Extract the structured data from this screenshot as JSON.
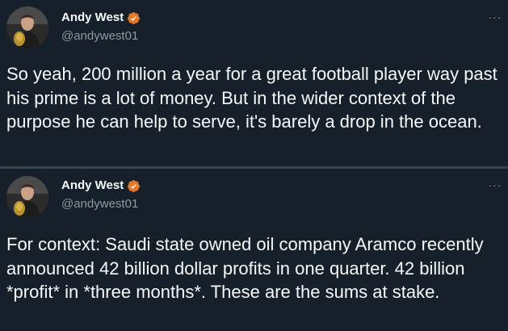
{
  "colors": {
    "background": "#15202b",
    "text": "#f7f9f9",
    "secondary_text": "#8b98a5",
    "verified_badge": "#e6782c",
    "divider": "#38444d"
  },
  "tweets": [
    {
      "author": {
        "display_name": "Andy West",
        "handle": "@andywest01",
        "verified_icon": "verified-badge-icon"
      },
      "more_icon": "more-horizontal-icon",
      "more_label": "···",
      "text": "So yeah, 200 million a year for a great football player way past his prime is a lot of money. But in the wider context of the purpose he can help to serve, it's barely a drop in the ocean."
    },
    {
      "author": {
        "display_name": "Andy West",
        "handle": "@andywest01",
        "verified_icon": "verified-badge-icon"
      },
      "more_icon": "more-horizontal-icon",
      "more_label": "···",
      "text": "For context: Saudi state owned oil company Aramco recently announced 42 billion dollar profits in one quarter. 42 billion *profit* in *three months*. These are the sums at stake."
    }
  ]
}
